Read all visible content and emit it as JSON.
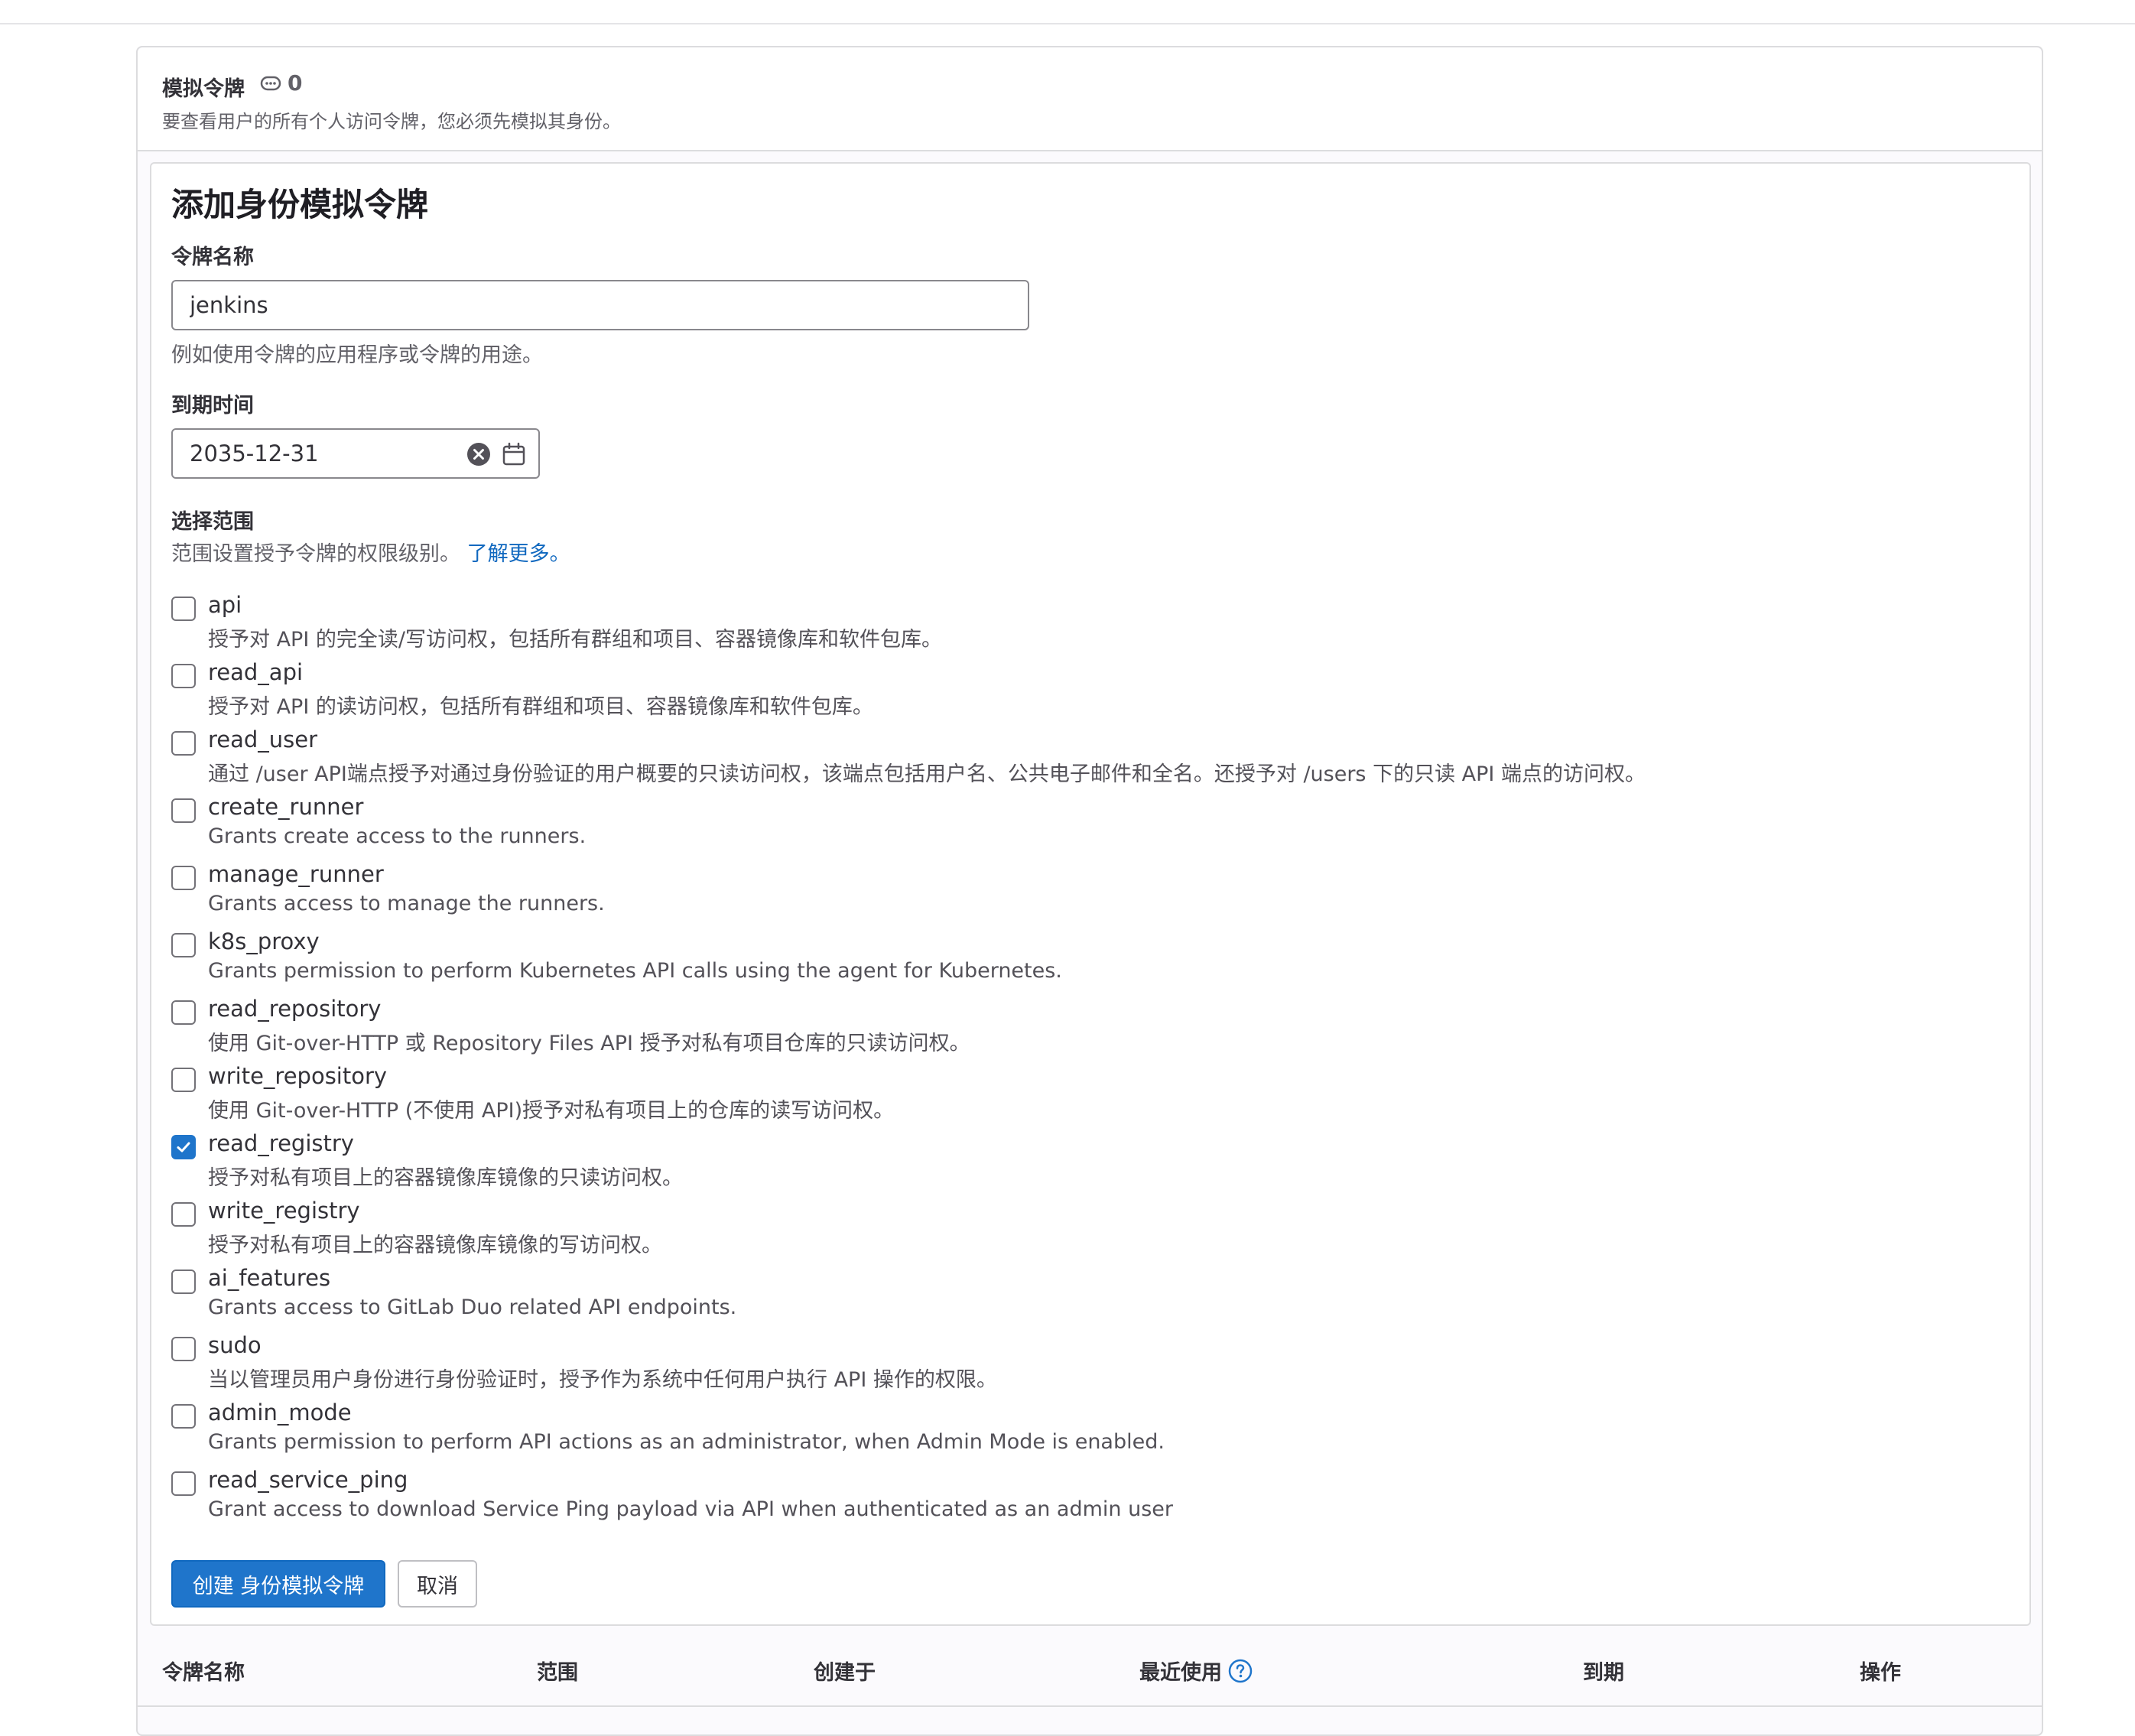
{
  "impersonation_tokens": {
    "title": "模拟令牌",
    "count": "0",
    "description": "要查看用户的所有个人访问令牌，您必须先模拟其身份。"
  },
  "form": {
    "title": "添加身份模拟令牌",
    "token_name": {
      "label": "令牌名称",
      "value": "jenkins",
      "help": "例如使用令牌的应用程序或令牌的用途。"
    },
    "expiry": {
      "label": "到期时间",
      "value": "2035-12-31"
    },
    "scopes": {
      "label": "选择范围",
      "help": "范围设置授予令牌的权限级别。",
      "learn_more": "了解更多。",
      "items": [
        {
          "name": "api",
          "description": "授予对 API 的完全读/写访问权，包括所有群组和项目、容器镜像库和软件包库。",
          "checked": false
        },
        {
          "name": "read_api",
          "description": "授予对 API 的读访问权，包括所有群组和项目、容器镜像库和软件包库。",
          "checked": false
        },
        {
          "name": "read_user",
          "description": "通过 /user API端点授予对通过身份验证的用户概要的只读访问权，该端点包括用户名、公共电子邮件和全名。还授予对 /users 下的只读 API 端点的访问权。",
          "checked": false
        },
        {
          "name": "create_runner",
          "description": "Grants create access to the runners.",
          "checked": false
        },
        {
          "name": "manage_runner",
          "description": "Grants access to manage the runners.",
          "checked": false
        },
        {
          "name": "k8s_proxy",
          "description": "Grants permission to perform Kubernetes API calls using the agent for Kubernetes.",
          "checked": false
        },
        {
          "name": "read_repository",
          "description": "使用 Git-over-HTTP 或 Repository Files API 授予对私有项目仓库的只读访问权。",
          "checked": false
        },
        {
          "name": "write_repository",
          "description": "使用 Git-over-HTTP (不使用 API)授予对私有项目上的仓库的读写访问权。",
          "checked": false
        },
        {
          "name": "read_registry",
          "description": "授予对私有项目上的容器镜像库镜像的只读访问权。",
          "checked": true
        },
        {
          "name": "write_registry",
          "description": "授予对私有项目上的容器镜像库镜像的写访问权。",
          "checked": false
        },
        {
          "name": "ai_features",
          "description": "Grants access to GitLab Duo related API endpoints.",
          "checked": false
        },
        {
          "name": "sudo",
          "description": "当以管理员用户身份进行身份验证时，授予作为系统中任何用户执行 API 操作的权限。",
          "checked": false
        },
        {
          "name": "admin_mode",
          "description": "Grants permission to perform API actions as an administrator, when Admin Mode is enabled.",
          "checked": false
        },
        {
          "name": "read_service_ping",
          "description": "Grant access to download Service Ping payload via API when authenticated as an admin user",
          "checked": false
        }
      ]
    },
    "buttons": {
      "create": "创建 身份模拟令牌",
      "cancel": "取消"
    }
  },
  "table": {
    "headers": [
      "令牌名称",
      "范围",
      "创建于",
      "最近使用",
      "到期",
      "操作"
    ]
  },
  "colors": {
    "primary": "#1f75cb",
    "link": "#1068bf",
    "border": "#dcdcde"
  }
}
